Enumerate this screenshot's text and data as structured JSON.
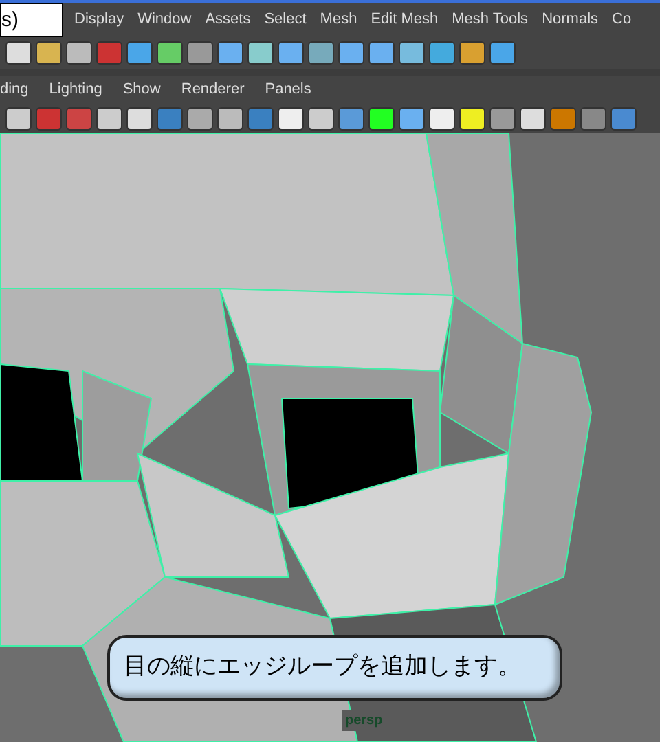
{
  "title_field": {
    "value": "s)"
  },
  "menu_bar": [
    "Display",
    "Window",
    "Assets",
    "Select",
    "Mesh",
    "Edit Mesh",
    "Mesh Tools",
    "Normals",
    "Co"
  ],
  "panel_menu": [
    "ding",
    "Lighting",
    "Show",
    "Renderer",
    "Panels"
  ],
  "caption": "目の縦にエッジループを追加します。",
  "camera_label": "persp"
}
